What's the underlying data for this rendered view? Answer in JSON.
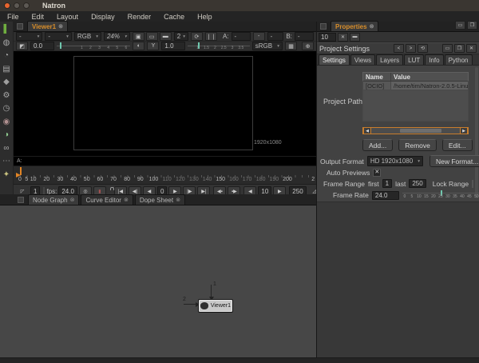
{
  "ui": {
    "close_glyph": "⊗",
    "dropdown_arrow": "▾"
  },
  "window": {
    "title": "Natron"
  },
  "menubar": {
    "items": [
      "File",
      "Edit",
      "Layout",
      "Display",
      "Render",
      "Cache",
      "Help"
    ]
  },
  "toolbar": {
    "icons": [
      {
        "name": "image-nodes-icon",
        "glyph": "▌",
        "color": "#6fae3f"
      },
      {
        "name": "draw-nodes-icon",
        "glyph": "◍",
        "color": "#a8a8a8"
      },
      {
        "name": "time-nodes-icon",
        "glyph": "◔",
        "color": "#a8a8a8"
      },
      {
        "name": "channel-nodes-icon",
        "glyph": "▤",
        "color": "#a8a8a8"
      },
      {
        "name": "color-nodes-icon",
        "glyph": "◆",
        "color": "#9f9f9f"
      },
      {
        "name": "filter-nodes-icon",
        "glyph": "⚙",
        "color": "#a8a8a8"
      },
      {
        "name": "keyer-nodes-icon",
        "glyph": "◷",
        "color": "#a8a8a8"
      },
      {
        "name": "merge-nodes-icon",
        "glyph": "◉",
        "color": "#b09090"
      },
      {
        "name": "transform-nodes-icon",
        "glyph": "◑",
        "color": "#8fc98f"
      },
      {
        "name": "views-nodes-icon",
        "glyph": "∞",
        "color": "#a8a8a8"
      },
      {
        "name": "other-nodes-icon",
        "glyph": "⋯",
        "color": "#a8a8a8"
      },
      {
        "name": "extra-nodes-icon",
        "glyph": "✦",
        "color": "#c9c27f"
      }
    ]
  },
  "viewer": {
    "tab_label": "Viewer1",
    "layer_value": "-",
    "alpha_value": "-",
    "channels_value": "RGB",
    "zoom_value": "24%",
    "icons_row1": [
      {
        "name": "clip-to-project-icon",
        "glyph": "▣"
      },
      {
        "name": "roi-icon",
        "glyph": "▭"
      },
      {
        "name": "full-frame-icon",
        "glyph": "▬"
      }
    ],
    "proxy_value": "2",
    "refresh_glyph": "⟳",
    "pause_glyph": "❘❘",
    "a_label": "A:",
    "a_value": "-",
    "wipe_value": "-",
    "b_label": "B:",
    "b_value": "-",
    "gain_glyph": "◩",
    "gain_value": "0.0",
    "gain_ticks": [
      {
        "label": "1",
        "x": 34
      },
      {
        "label": "2",
        "x": 46
      },
      {
        "label": "3",
        "x": 58
      },
      {
        "label": "4",
        "x": 70
      },
      {
        "label": "5",
        "x": 82
      },
      {
        "label": "6",
        "x": 94
      }
    ],
    "contrast_glyph": "◐",
    "gamma_glyph": "Y",
    "gamma_value": "1.0",
    "gamma_ticks": [
      {
        "label": "1",
        "x": 16
      },
      {
        "label": "1.5",
        "x": 30
      },
      {
        "label": "2",
        "x": 44
      },
      {
        "label": "2.5",
        "x": 58
      },
      {
        "label": "3",
        "x": 72
      },
      {
        "label": "3.5",
        "x": 86
      }
    ],
    "lut_value": "sRGB",
    "checker_glyph": "▦",
    "picker_glyph": "⊕",
    "format_label": "1920x1080",
    "info_a_label": "A:"
  },
  "timeline": {
    "ticks": [
      {
        "label": "0",
        "x": 2.1
      },
      {
        "label": "5",
        "x": 4.3
      },
      {
        "label": "10",
        "x": 6.5
      },
      {
        "label": "20",
        "x": 10.9
      },
      {
        "label": "30",
        "x": 15.4
      },
      {
        "label": "40",
        "x": 19.8
      },
      {
        "label": "50",
        "x": 24.2
      },
      {
        "label": "60",
        "x": 28.6
      },
      {
        "label": "70",
        "x": 33.0
      },
      {
        "label": "80",
        "x": 37.5
      },
      {
        "label": "90",
        "x": 41.9
      },
      {
        "label": "100",
        "x": 46.3
      },
      {
        "label": "110",
        "x": 50.7,
        "dim": true
      },
      {
        "label": "120",
        "x": 55.1,
        "dim": true
      },
      {
        "label": "130",
        "x": 59.6,
        "dim": true
      },
      {
        "label": "140",
        "x": 64.0,
        "dim": true
      },
      {
        "label": "150",
        "x": 68.4
      },
      {
        "label": "160",
        "x": 72.8,
        "dim": true
      },
      {
        "label": "170",
        "x": 77.2,
        "dim": true
      },
      {
        "label": "180",
        "x": 81.7,
        "dim": true
      },
      {
        "label": "190",
        "x": 86.1,
        "dim": true
      },
      {
        "label": "200",
        "x": 90.5
      },
      {
        "label": "2",
        "x": 99.0
      }
    ]
  },
  "playback": {
    "corner_in_glyph": "◸",
    "corner_out_glyph": "◿",
    "in_value": "1",
    "fps_label": "fps:",
    "fps_value": "24.0",
    "turntable_glyph": "◎",
    "cadence_glyph": "▮",
    "current_value": "0",
    "skip_value": "10",
    "out_value": "250",
    "buttons_left": [
      {
        "name": "first-frame-button",
        "glyph": "|◀"
      },
      {
        "name": "prev-keyframe-button",
        "glyph": "◀|"
      },
      {
        "name": "play-backward-button",
        "glyph": "◀"
      }
    ],
    "buttons_right": [
      {
        "name": "play-forward-button",
        "glyph": "▶"
      },
      {
        "name": "next-keyframe-button",
        "glyph": "|▶"
      },
      {
        "name": "last-frame-button",
        "glyph": "▶|"
      }
    ],
    "nav_buttons": [
      {
        "name": "prev-increment-button",
        "glyph": "◀▪"
      },
      {
        "name": "next-increment-button",
        "glyph": "▪▶"
      }
    ],
    "skip_back_glyph": "◀",
    "skip_fwd_glyph": "▶"
  },
  "bottom": {
    "tabs": [
      {
        "label": "Node Graph",
        "active": true
      },
      {
        "label": "Curve Editor"
      },
      {
        "label": "Dope Sheet"
      }
    ]
  },
  "nodegraph": {
    "node_label": "Viewer1",
    "input1_label": "1",
    "input2_label": "2"
  },
  "properties": {
    "tab_label": "Properties",
    "max_panels_value": "10",
    "clear_glyph": "✕",
    "minimize_all_glyph": "▬",
    "float_glyph": "❒",
    "min_glyph": "▭",
    "panel": {
      "title": "Project Settings",
      "prev_glyph": "<",
      "next_glyph": ">",
      "undo_glyph": "⟲",
      "minimize_glyph": "▭",
      "float_glyph": "❒",
      "close_glyph": "✕",
      "tabs": [
        {
          "label": "Settings",
          "active": true
        },
        {
          "label": "Views"
        },
        {
          "label": "Layers"
        },
        {
          "label": "LUT"
        },
        {
          "label": "Info"
        },
        {
          "label": "Python"
        }
      ],
      "table": {
        "name_header": "Name",
        "value_header": "Value",
        "rows": [
          {
            "name": "[OCIO]",
            "value": "/home/tim/Natron-2.0.5-Linux-x86"
          }
        ]
      },
      "scroll_left_glyph": "◀",
      "scroll_right_glyph": "▶",
      "project_paths_label": "Project Paths",
      "add_button": "Add...",
      "remove_button": "Remove",
      "edit_button": "Edit...",
      "output_format_label": "Output Format",
      "output_format_value": "HD 1920x1080",
      "new_format_button": "New Format...",
      "auto_previews_label": "Auto Previews",
      "auto_previews_checked": "✕",
      "frame_range_label": "Frame Range",
      "first_label": "first",
      "first_value": "1",
      "last_label": "last",
      "last_value": "250",
      "lock_range_label": "Lock Range",
      "frame_rate_label": "Frame Rate",
      "frame_rate_value": "24.0",
      "frame_rate_marker_x": 48,
      "frame_rate_ticks": [
        {
          "label": "0",
          "x": 3
        },
        {
          "label": "5",
          "x": 12
        },
        {
          "label": "10",
          "x": 21
        },
        {
          "label": "15",
          "x": 30
        },
        {
          "label": "20",
          "x": 39
        },
        {
          "label": "25",
          "x": 48
        },
        {
          "label": "30",
          "x": 57
        },
        {
          "label": "35",
          "x": 66
        },
        {
          "label": "40",
          "x": 75
        },
        {
          "label": "45",
          "x": 84
        },
        {
          "label": "50",
          "x": 93
        }
      ]
    }
  }
}
